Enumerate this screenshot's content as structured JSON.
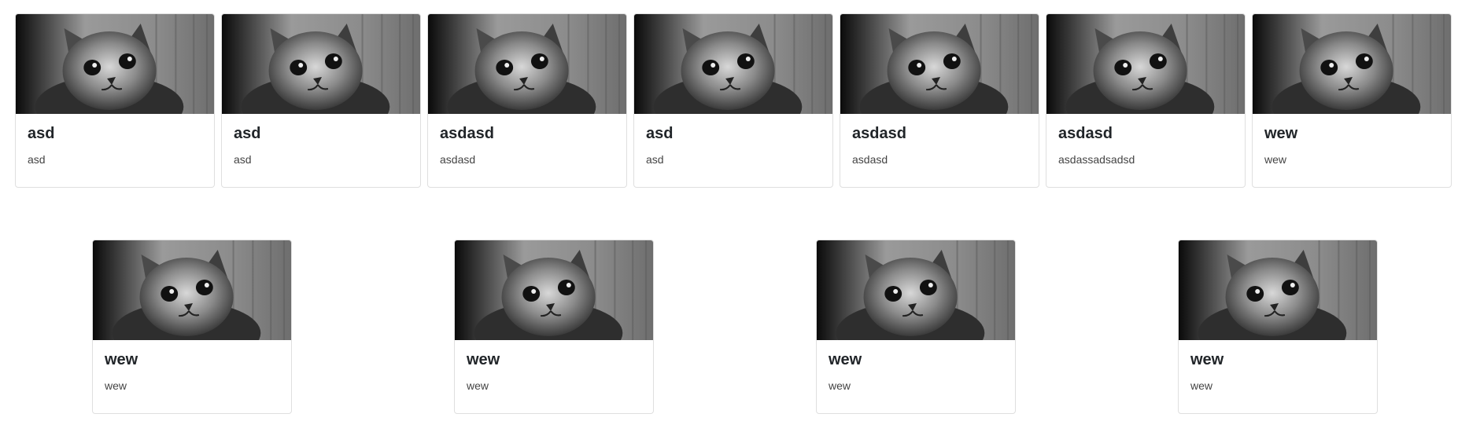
{
  "cards_row_1": [
    {
      "title": "asd",
      "text": "asd",
      "image": "kitten-photo"
    },
    {
      "title": "asd",
      "text": "asd",
      "image": "kitten-photo"
    },
    {
      "title": "asdasd",
      "text": "asdasd",
      "image": "kitten-photo"
    },
    {
      "title": "asd",
      "text": "asd",
      "image": "kitten-photo"
    },
    {
      "title": "asdasd",
      "text": "asdasd",
      "image": "kitten-photo"
    },
    {
      "title": "asdasd",
      "text": "asdassadsadsd",
      "image": "kitten-photo"
    },
    {
      "title": "wew",
      "text": "wew",
      "image": "kitten-photo"
    }
  ],
  "cards_row_2": [
    {
      "title": "wew",
      "text": "wew",
      "image": "kitten-photo"
    },
    {
      "title": "wew",
      "text": "wew",
      "image": "kitten-photo"
    },
    {
      "title": "wew",
      "text": "wew",
      "image": "kitten-photo"
    },
    {
      "title": "wew",
      "text": "wew",
      "image": "kitten-photo"
    }
  ]
}
